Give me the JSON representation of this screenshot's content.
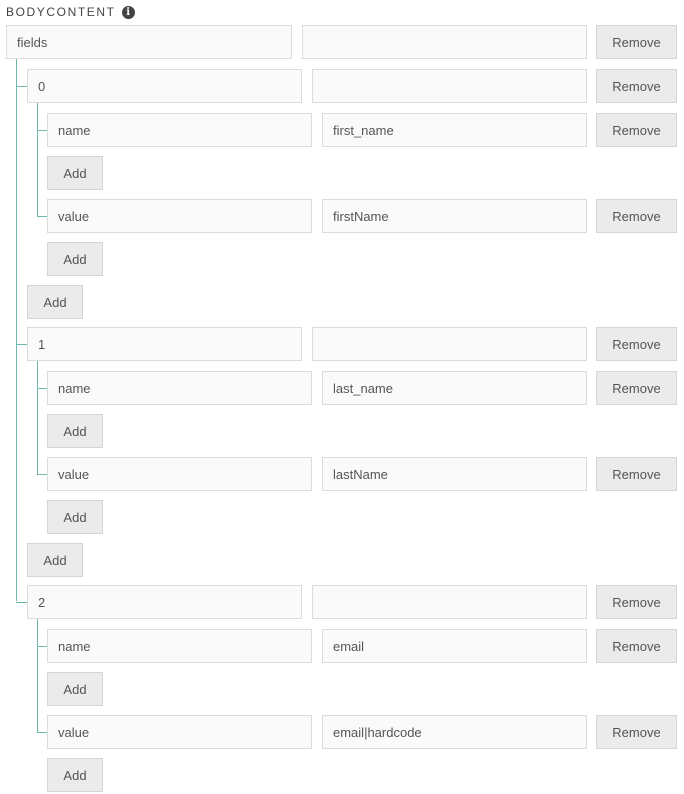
{
  "section": {
    "title": "BODYCONTENT",
    "info_icon": "info-icon"
  },
  "labels": {
    "remove": "Remove",
    "add": "Add"
  },
  "root": {
    "key": "fields",
    "value": "",
    "items": [
      {
        "index": "0",
        "value": "",
        "props": [
          {
            "key": "name",
            "value": "first_name"
          },
          {
            "key": "value",
            "value": "firstName"
          }
        ]
      },
      {
        "index": "1",
        "value": "",
        "props": [
          {
            "key": "name",
            "value": "last_name"
          },
          {
            "key": "value",
            "value": "lastName"
          }
        ]
      },
      {
        "index": "2",
        "value": "",
        "props": [
          {
            "key": "name",
            "value": "email"
          },
          {
            "key": "value",
            "value": "email|hardcode"
          }
        ]
      }
    ]
  },
  "colors": {
    "tree_line": "#6fb8ad",
    "button_bg": "#ebebeb",
    "field_bg": "#fafafa"
  }
}
